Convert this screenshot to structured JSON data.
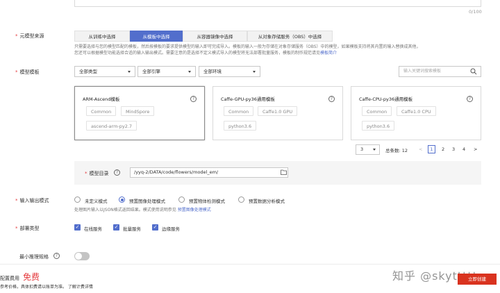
{
  "description": {
    "counter": "0/100"
  },
  "source": {
    "label": "元模型来源",
    "tabs": [
      {
        "label": "从训练中选择",
        "active": false
      },
      {
        "label": "从模板中选择",
        "active": true
      },
      {
        "label": "从容器镜像中选择",
        "active": false
      },
      {
        "label": "从对象存储服务（OBS）中选择",
        "active": false
      }
    ],
    "desc_line1": "只需要选择与您的模型匹配的模板，然后按模板的要求提供模型的输入即可完成导入。模板的输入一般为存储在对象存储服务（OBS）中的模型，如果模板支持将其内置的输入替换成其他，",
    "desc_line2": "您还可以根据模型功能选择合适的输入输出模式。需要注意的是选择不定义模式导入的模型将无法部署批量服务，模板的制作规范请见",
    "desc_link": "模板简介"
  },
  "template": {
    "label": "模型模板",
    "filters": [
      "全部类型",
      "全部引擎",
      "全部环境"
    ],
    "search_placeholder": "输入关键词搜索模板",
    "cards": [
      {
        "title": "ARM-Ascend模板",
        "tags": [
          "Common",
          "MindSpore",
          "ascend-arm-py2.7"
        ],
        "selected": true
      },
      {
        "title": "Caffe-GPU-py36通用模板",
        "tags": [
          "Common",
          "Caffe1.0 GPU",
          "python3.6"
        ],
        "selected": false
      },
      {
        "title": "Caffe-CPU-py36通用模板",
        "tags": [
          "Common",
          "Caffe1.0 CPU",
          "python3.6"
        ],
        "selected": false
      }
    ],
    "help_glyph": "?"
  },
  "pagination": {
    "page_size": "3",
    "total_label": "总条数: 12",
    "prev": "<",
    "pages": [
      "1",
      "2",
      "3",
      "4"
    ],
    "current": "1",
    "next": ">"
  },
  "model_dir": {
    "label": "模型目录",
    "value": "/yyq-2/DATA/code/flowers/model_em/"
  },
  "io_mode": {
    "label": "输入输出模式",
    "options": [
      {
        "label": "未定义模式",
        "selected": false
      },
      {
        "label": "预置图像处理模式",
        "selected": true
      },
      {
        "label": "预置物体检测模式",
        "selected": false
      },
      {
        "label": "预置数据分析模式",
        "selected": false
      }
    ],
    "note": "处理图片输入以JSON格式返回结果。模式使用说明参见",
    "note_link": "预置图像处理模式"
  },
  "deploy": {
    "label": "部署类型",
    "options": [
      {
        "label": "在线服务",
        "checked": true
      },
      {
        "label": "批量服务",
        "checked": true
      },
      {
        "label": "边缘服务",
        "checked": true
      }
    ]
  },
  "min_spec": {
    "label": "最小推理规格"
  },
  "footer": {
    "config_label": "配置费用",
    "free": "免费",
    "note": "参考价格，具体扣费请以账单为准。 了解计费详情",
    "submit": "立即创建",
    "watermark": "知乎 @skyttttt"
  }
}
